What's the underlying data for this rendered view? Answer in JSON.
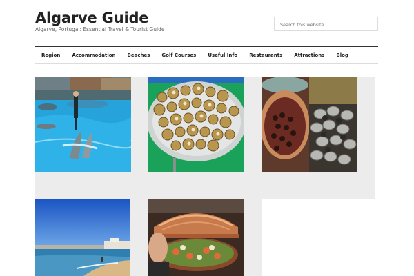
{
  "site": {
    "title": "Algarve Guide",
    "description": "Algarve, Portugal: Essential Travel & Tourist Guide"
  },
  "search": {
    "placeholder": "Search this website …"
  },
  "nav": {
    "items": [
      {
        "label": "Region"
      },
      {
        "label": "Accommodation"
      },
      {
        "label": "Beaches"
      },
      {
        "label": "Golf Courses"
      },
      {
        "label": "Useful Info"
      },
      {
        "label": "Restaurants"
      },
      {
        "label": "Attractions"
      },
      {
        "label": "Blog"
      }
    ]
  },
  "tiles": [
    {
      "icon": "dolphin-show-photo"
    },
    {
      "icon": "snails-dish-photo"
    },
    {
      "icon": "spices-market-photo"
    },
    {
      "icon": "beach-photo"
    },
    {
      "icon": "cataplana-dish-photo"
    }
  ]
}
